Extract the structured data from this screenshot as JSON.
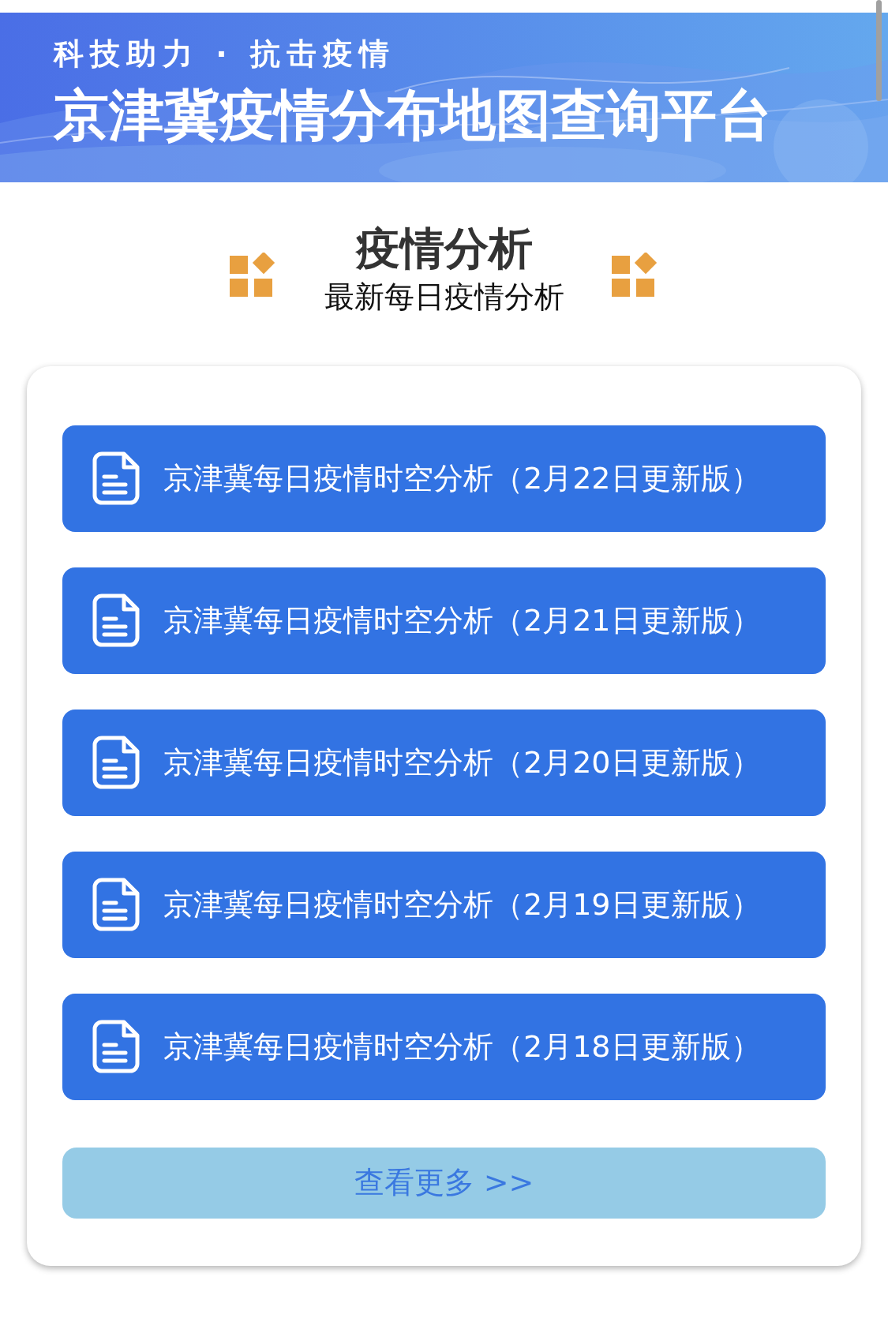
{
  "banner": {
    "tagline": "科技助力 · 抗击疫情",
    "title": "京津冀疫情分布地图查询平台"
  },
  "section": {
    "title": "疫情分析",
    "subtitle": "最新每日疫情分析"
  },
  "reports": [
    {
      "label": "京津冀每日疫情时空分析（2月22日更新版）"
    },
    {
      "label": "京津冀每日疫情时空分析（2月21日更新版）"
    },
    {
      "label": "京津冀每日疫情时空分析（2月20日更新版）"
    },
    {
      "label": "京津冀每日疫情时空分析（2月19日更新版）"
    },
    {
      "label": "京津冀每日疫情时空分析（2月18日更新版）"
    }
  ],
  "more_button": "查看更多 >>"
}
